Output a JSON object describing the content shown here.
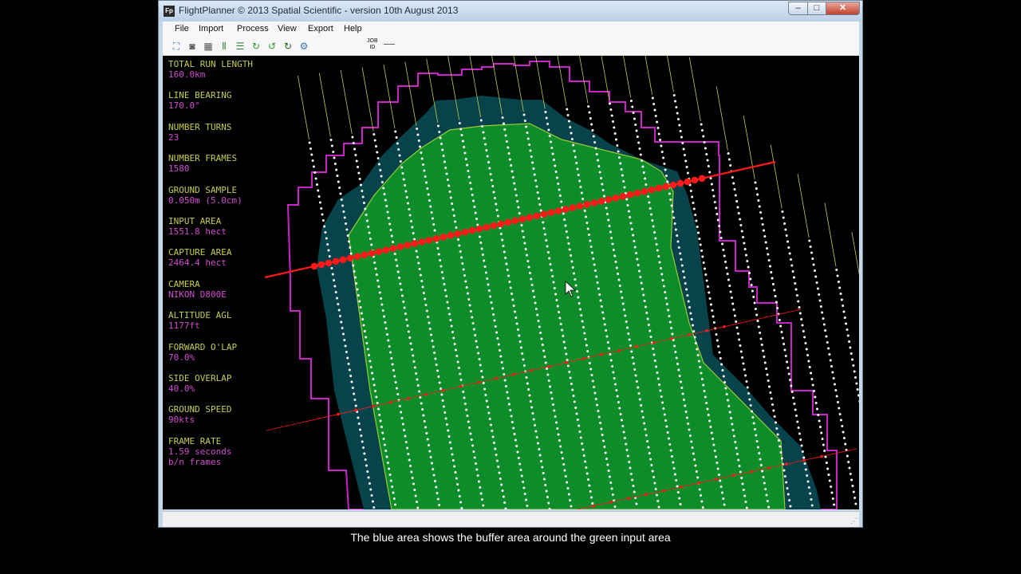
{
  "window": {
    "title": "FlightPlanner © 2013 Spatial Scientific - version 10th August 2013",
    "app_icon": "Fp",
    "controls": {
      "minimize": "–",
      "maximize": "□",
      "close": "✕"
    }
  },
  "menu": [
    "File",
    "Import",
    "Process",
    "View",
    "Export",
    "Help"
  ],
  "toolbar": {
    "icons": [
      "zoom-extent-icon",
      "camera-icon",
      "calculator-icon",
      "vertical-lines-icon",
      "horizontal-lines-icon",
      "refresh-green-icon",
      "refresh-green-alt-icon",
      "refresh-dark-icon",
      "settings-gear-icon"
    ],
    "job_id_label_line1": "JOB",
    "job_id_label_line2": "ID"
  },
  "stats": [
    {
      "label": "TOTAL RUN LENGTH",
      "value": "160.0km"
    },
    {
      "label": "LINE BEARING",
      "value": "170.0°"
    },
    {
      "label": "NUMBER TURNS",
      "value": "23"
    },
    {
      "label": "NUMBER FRAMES",
      "value": "1580"
    },
    {
      "label": "GROUND SAMPLE",
      "value": "0.050m (5.0cm)"
    },
    {
      "label": "INPUT AREA",
      "value": "1551.8 hect"
    },
    {
      "label": "CAPTURE AREA",
      "value": "2464.4 hect"
    },
    {
      "label": "CAMERA",
      "value": "NIKON D800E"
    },
    {
      "label": "ALTITUDE AGL",
      "value": "1177ft"
    },
    {
      "label": "FORWARD O'LAP",
      "value": "70.0%"
    },
    {
      "label": "SIDE OVERLAP",
      "value": "40.0%"
    },
    {
      "label": "GROUND SPEED",
      "value": "90kts"
    },
    {
      "label": "FRAME RATE",
      "value": "1.59 seconds",
      "value2": "b/n frames"
    }
  ],
  "map": {
    "colors": {
      "background": "#000000",
      "input_area": "#0f8c2a",
      "input_area_edge": "#9acd32",
      "buffer_area": "#06434a",
      "capture_boundary": "#c824c8",
      "flight_line_tail": "#c8c850",
      "frame_dot": "#ffffff",
      "cross_line": "#ff1a1a"
    }
  },
  "caption": "The blue area shows the buffer area around the green input area"
}
